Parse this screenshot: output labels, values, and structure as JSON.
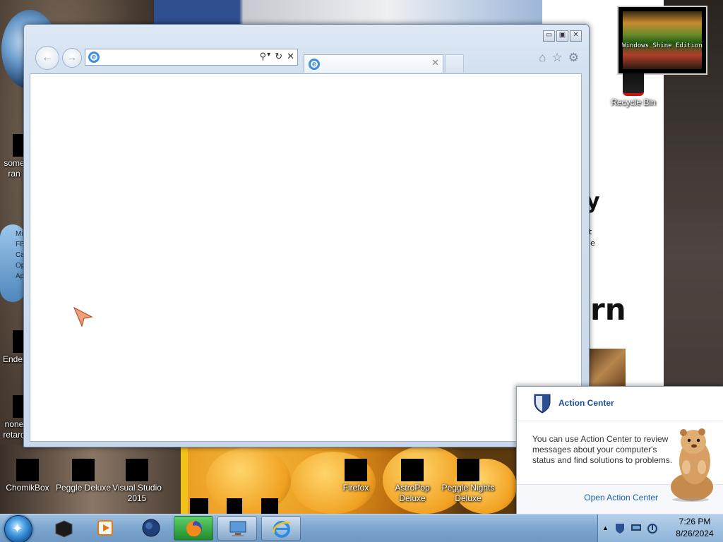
{
  "desktop": {
    "icons": [
      {
        "label": "some\nran",
        "name": "desktop-icon-some-ran"
      },
      {
        "label": "Ender",
        "name": "desktop-icon-ender"
      },
      {
        "label": "none\nretard",
        "name": "desktop-icon-none-retard"
      },
      {
        "label": "ChomikBox",
        "name": "desktop-icon-chomikbox"
      },
      {
        "label": "Peggle Deluxe",
        "name": "desktop-icon-peggle-deluxe"
      },
      {
        "label": "Visual Studio\n2015",
        "name": "desktop-icon-visual-studio"
      },
      {
        "label": "Firefox",
        "name": "desktop-icon-firefox"
      },
      {
        "label": "AstroPop\nDeluxe",
        "name": "desktop-icon-astropop"
      },
      {
        "label": "Peggle Nights\nDeluxe",
        "name": "desktop-icon-peggle-nights"
      },
      {
        "label": "Recycle Bin",
        "name": "desktop-icon-recycle-bin"
      }
    ],
    "gadget_blue_lines": [
      "Mi",
      "FB",
      "Ca",
      "Op",
      "Ap"
    ],
    "shine_caption": "Windows Shine Edition",
    "background_text": {
      "partial_right": "rn",
      "y_fragment": "y",
      "t_fragment": "t",
      "e_fragment": "e"
    }
  },
  "browser": {
    "address": "",
    "address_tools": {
      "search": "⚲",
      "dropdown": "▾",
      "refresh": "↻",
      "stop": "✕"
    },
    "tab": {
      "title": "",
      "close": "✕"
    },
    "window_controls": {
      "minimize": "▭",
      "maximize": "▣",
      "close": "✕"
    },
    "nav": {
      "back": "←",
      "forward": "→"
    },
    "command_icons": {
      "home": "⌂",
      "favorites": "☆",
      "tools": "⚙"
    }
  },
  "action_center": {
    "title": "Action Center",
    "message": "You can use Action Center to review messages about your computer's status and find solutions to problems.",
    "link": "Open Action Center",
    "accent": "#1b4f9c"
  },
  "taskbar": {
    "items": [
      {
        "name": "taskbar-item-app-black",
        "active": false
      },
      {
        "name": "taskbar-item-media-player",
        "active": false
      },
      {
        "name": "taskbar-item-globe",
        "active": false
      },
      {
        "name": "taskbar-item-firefox",
        "active": true
      },
      {
        "name": "taskbar-item-remote-desktop",
        "active": true
      },
      {
        "name": "taskbar-item-internet-explorer",
        "active": true
      }
    ],
    "clock": {
      "time": "7:26 PM",
      "date": "8/26/2024"
    },
    "tray_expand": "▲"
  }
}
